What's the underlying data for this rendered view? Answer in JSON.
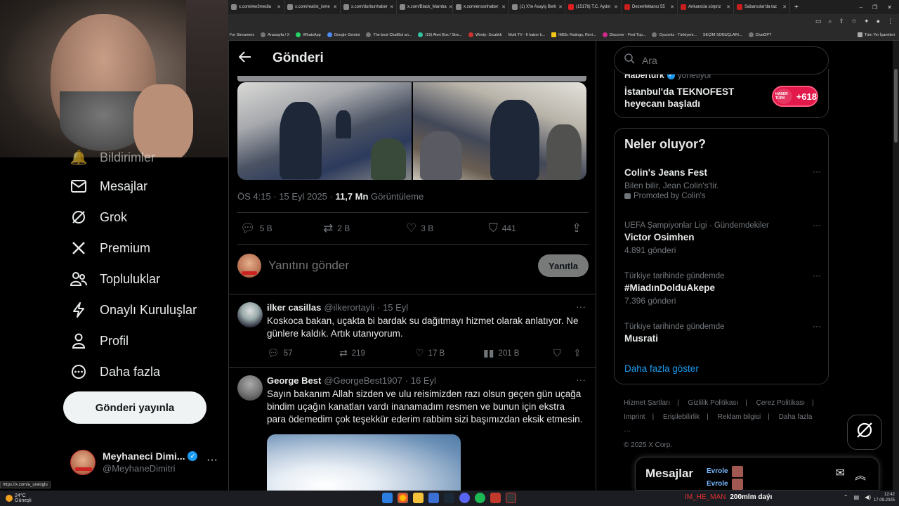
{
  "browser": {
    "tabs": [
      {
        "label": "x.com/ww3media"
      },
      {
        "label": "x.com/realist_isme"
      },
      {
        "label": "x.com/durbunhaber"
      },
      {
        "label": "x.com/Black_Mamba"
      },
      {
        "label": "x.com/ensonhaber"
      },
      {
        "label": "(1) X'te Asayiş Berk"
      },
      {
        "label": "(15176) T.C. Aydın"
      },
      {
        "label": "Dezenfektancı 55"
      },
      {
        "label": "Ankara'da sürpriz"
      },
      {
        "label": "Sabancılar'da taz"
      }
    ],
    "bookmarks": [
      "For Streamers",
      "Anasayfa / X",
      "WhatsApp",
      "Google Gemini",
      "The best ChatBot an...",
      "(19) Alert Box / Stre...",
      "Windy: Sıcaklık",
      "Multi TV - 6 haber k...",
      "IMDb: Ratings, Revi...",
      "Discover - Find Top...",
      "Oyuneks - Türkiyeni...",
      "SEÇİM SONUÇLARI...",
      "ChatGPT"
    ],
    "bookmarks_folder": "Tüm Yer İşaretleri",
    "status_link": "https://x.com/a_uraloglu"
  },
  "sidebar": {
    "partial_item": "Bildirimler",
    "items": [
      {
        "label": "Mesajlar",
        "icon": "envelope-icon"
      },
      {
        "label": "Grok",
        "icon": "grok-icon"
      },
      {
        "label": "Premium",
        "icon": "x-logo-icon"
      },
      {
        "label": "Topluluklar",
        "icon": "people-icon"
      },
      {
        "label": "Onaylı Kuruluşlar",
        "icon": "lightning-icon"
      },
      {
        "label": "Profil",
        "icon": "person-icon"
      },
      {
        "label": "Daha fazla",
        "icon": "more-circle-icon"
      }
    ],
    "post_button": "Gönderi yayınla",
    "account": {
      "name": "Meyhaneci Dimi...",
      "handle": "@MeyhaneDimitri",
      "more": "···"
    }
  },
  "main": {
    "header": {
      "title": "Gönderi"
    },
    "post_meta": {
      "time": "ÖS 4:15 · 15 Eyl 2025 · ",
      "views": "11,7 Mn",
      "views_label": " Görüntüleme"
    },
    "actions": {
      "replies": "5 B",
      "reposts": "2 B",
      "likes": "3 B",
      "bookmarks": "441"
    },
    "reply": {
      "placeholder": "Yanıtını gönder",
      "button": "Yanıtla"
    },
    "tweets": [
      {
        "name": "ilker casillas",
        "handle": "@ilkerortayli",
        "date": "· 15 Eyl",
        "text": "Koskoca bakan, uçakta bi bardak su dağıtmayı hizmet olarak anlatıyor. Ne günlere kaldık. Artık utanıyorum.",
        "replies": "57",
        "reposts": "219",
        "likes": "17 B",
        "views": "201 B"
      },
      {
        "name": "George Best",
        "handle": "@GeorgeBest1907",
        "date": "· 16 Eyl",
        "text": "Sayın bakanım Allah sizden ve ulu reisimizden razı olsun geçen gün uçağa bindim uçağın kanatları vardı inanamadım resmen ve bunun için ekstra para ödemedim çok teşekkür ederim rabbim sizi başımızdan eksik etmesin."
      }
    ]
  },
  "right": {
    "search": {
      "placeholder": "Ara"
    },
    "ad": {
      "sponsor": "Haberturk",
      "sponsor_suffix": "yönetiyor",
      "title": "İstanbul'da TEKNOFEST heyecanı başladı",
      "count": "+618",
      "logo_text": "HABER TÜRK"
    },
    "trends_title": "Neler oluyor?",
    "trends": [
      {
        "context": "",
        "name": "Colin's Jeans Fest",
        "sub": "Bilen bilir, Jean Colin's'tir.",
        "promoted": "Promoted by Colin's"
      },
      {
        "context": "UEFA Şampiyonlar Ligi · Gündemdekiler",
        "name": "Victor Osimhen",
        "sub": "4.891 gönderi"
      },
      {
        "context": "Türkiye tarihinde gündemde",
        "name": "#MiadınDolduAkepe",
        "sub": "7.396 gönderi"
      },
      {
        "context": "Türkiye tarihinde gündemde",
        "name": "Musrati",
        "sub": ""
      }
    ],
    "show_more": "Daha fazla göster",
    "footer": [
      "Hizmet Şartları",
      "|",
      "Gizlilik Politikası",
      "|",
      "Çerez Politikası",
      "|",
      "Imprint",
      "|",
      "Erişilebilirlik",
      "|",
      "Reklam bilgisi",
      "|",
      "Daha fazla ···",
      "© 2025 X Corp."
    ]
  },
  "messages_dock": {
    "title": "Mesajlar",
    "user1": "Evrole",
    "user2": "Evrole"
  },
  "taskbar": {
    "weather_temp": "24°C",
    "weather_desc": "Güneşli",
    "ticker_red": "IM_HE_MAN",
    "ticker_text": "200mlm daýı",
    "time": "12:42",
    "date": "17.09.2025"
  }
}
